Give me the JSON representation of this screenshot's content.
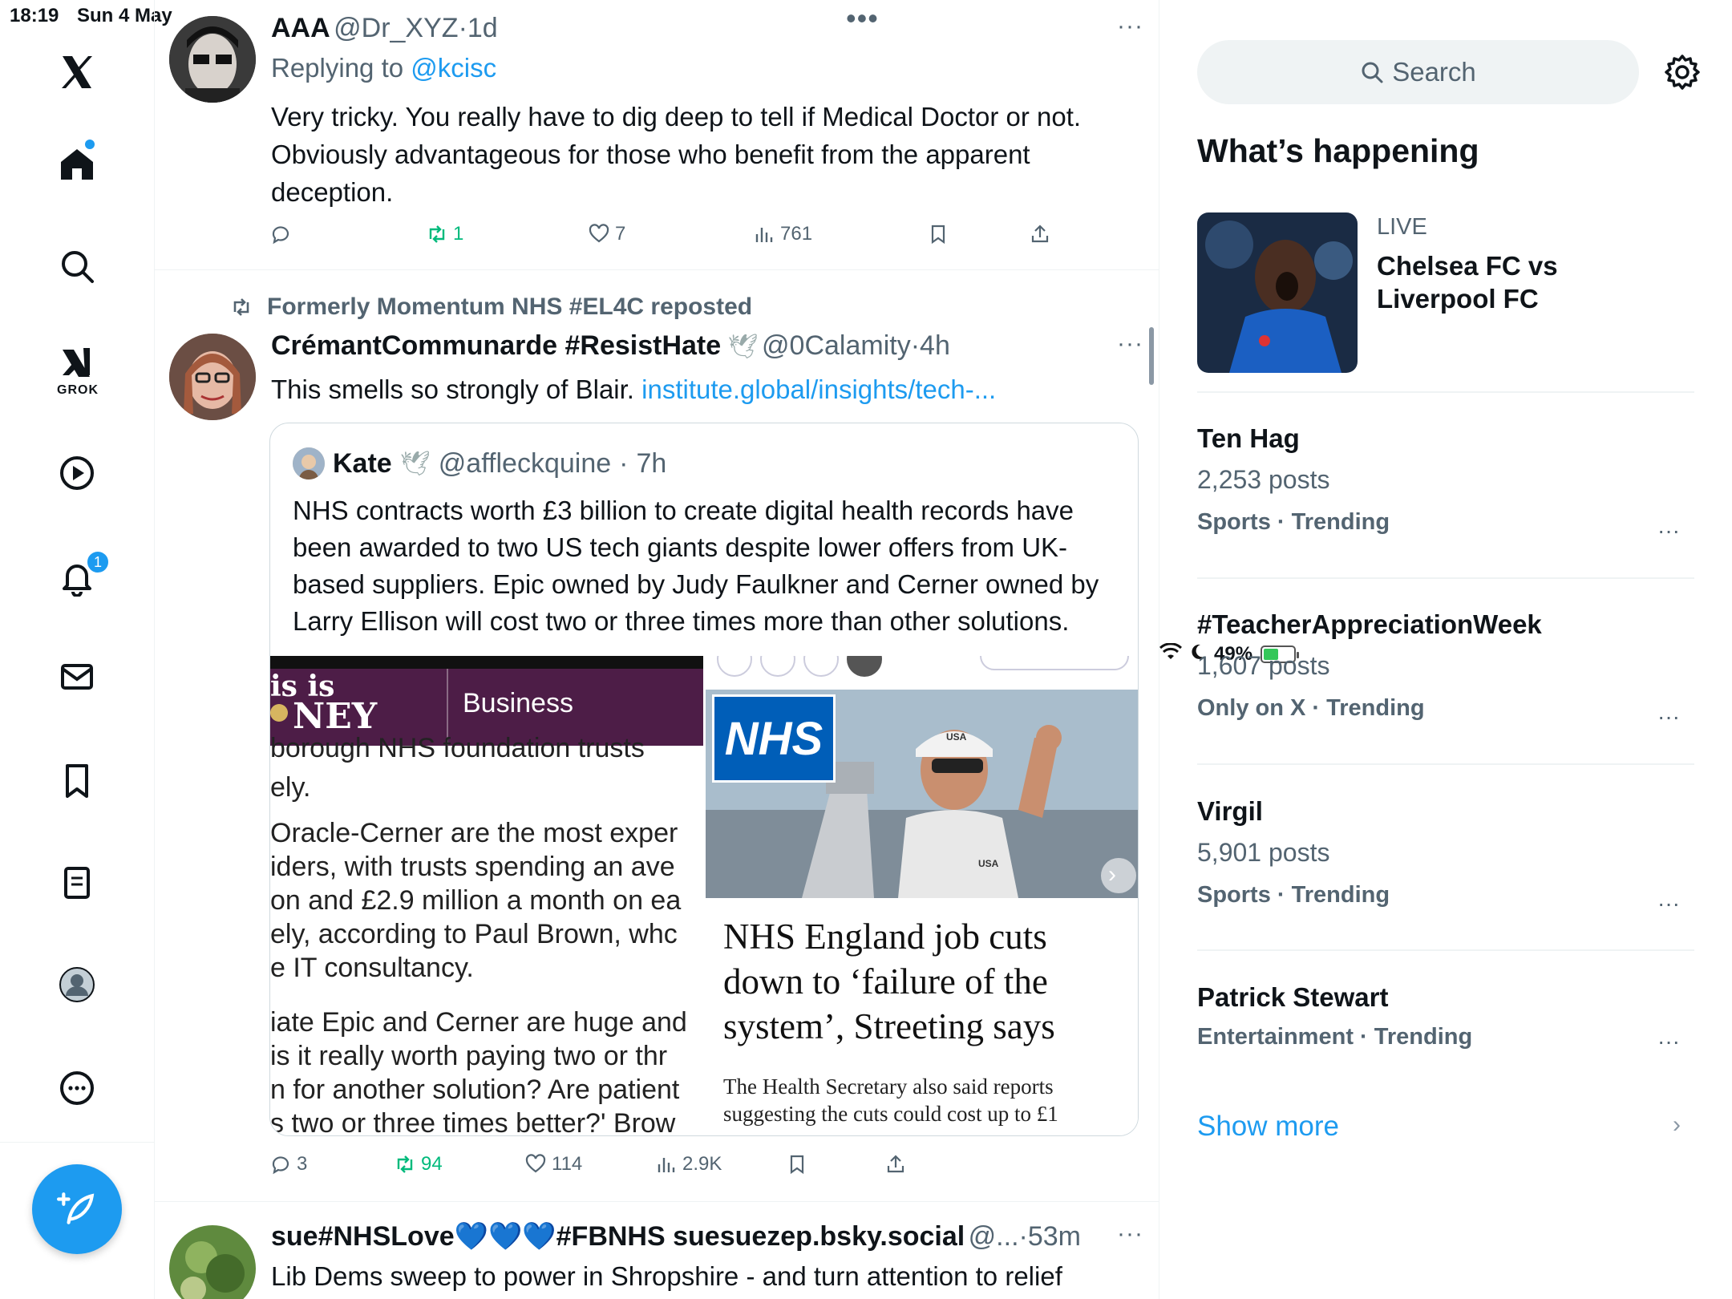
{
  "status_bar": {
    "time": "18:19",
    "date": "Sun 4 May",
    "battery": "49%"
  },
  "nav": {
    "grok_label": "GROK",
    "notifications_badge": "1"
  },
  "tweet1": {
    "name": "AAA",
    "handle": "@Dr_XYZ",
    "time": "1d",
    "replying_prefix": "Replying to ",
    "replying_to": "@kcisc",
    "text": "Very tricky. You really have to dig deep to tell if Medical Doctor or not. Obviously advantageous for those who benefit from the apparent deception.",
    "retweets": "1",
    "likes": "7",
    "views": "761"
  },
  "tweet2": {
    "reposted_by": "Formerly Momentum NHS #EL4C reposted",
    "name": "CrémantCommunarde #ResistHate",
    "handle": "@0Calamity",
    "time": "4h",
    "text": "This smells so strongly of Blair. ",
    "link": "institute.global/insights/tech-...",
    "replies": "3",
    "retweets": "94",
    "likes": "114",
    "views": "2.9K",
    "quote": {
      "name": "Kate",
      "handle": "@affleckquine",
      "time": "7h",
      "text": "NHS contracts worth £3 billion to create digital health records have been awarded to two US tech giants despite lower offers from UK-based suppliers. Epic owned by Judy Faulkner and Cerner owned by Larry Ellison will cost two or three times more than other solutions.",
      "left_image": {
        "brand_top": "is is",
        "brand_bottom": "NEY",
        "section": "Business",
        "lines": [
          "borough NHS foundation trusts",
          "ely.",
          "Oracle-Cerner are the most exper",
          "iders, with trusts spending an ave",
          "on and £2.9 million a month on ea",
          "ely, according to Paul Brown, whc",
          "e IT consultancy.",
          "iate Epic and Cerner are huge and",
          "is it really worth paying two or thr",
          "n for another solution? Are patient",
          "s two or three times better?' Brow"
        ]
      },
      "right_image": {
        "logo": "NHS",
        "cap_text": "USA",
        "shirt_text": "USA",
        "headline": "NHS England job cuts down to ‘failure of the system’, Streeting says",
        "standfirst": "The Health Secretary also said reports suggesting the cuts could cost up to £1"
      }
    }
  },
  "tweet3": {
    "name": "sue#NHSLove💙💙💙#FBNHS suesuezep.bsky.social",
    "handle": "@...",
    "time": "53m",
    "text": "Lib Dems sweep to power in Shropshire - and turn attention to relief"
  },
  "sidebar": {
    "search_placeholder": "Search",
    "title": "What’s happening",
    "live": {
      "label": "LIVE",
      "title": "Chelsea FC vs Liverpool FC"
    },
    "trends": [
      {
        "name": "Ten Hag",
        "posts": "2,253 posts",
        "context": "Sports · Trending"
      },
      {
        "name": "#TeacherAppreciationWeek",
        "posts": "1,607 posts",
        "context": "Only on X · Trending"
      },
      {
        "name": "Virgil",
        "posts": "5,901 posts",
        "context": "Sports · Trending"
      },
      {
        "name": "Patrick Stewart",
        "posts": "",
        "context": "Entertainment · Trending"
      }
    ],
    "show_more": "Show more"
  },
  "colors": {
    "accent": "#1d9bf0",
    "retweet_green": "#00ba7c",
    "muted": "#536471"
  }
}
